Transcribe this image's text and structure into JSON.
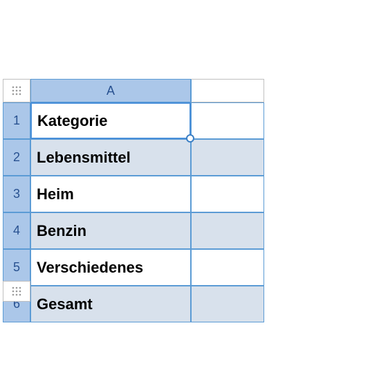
{
  "column_header": "A",
  "rows": [
    {
      "num": "1",
      "value": "Kategorie"
    },
    {
      "num": "2",
      "value": "Lebensmittel"
    },
    {
      "num": "3",
      "value": "Heim"
    },
    {
      "num": "4",
      "value": "Benzin"
    },
    {
      "num": "5",
      "value": "Verschiedenes"
    },
    {
      "num": "6",
      "value": "Gesamt"
    }
  ]
}
